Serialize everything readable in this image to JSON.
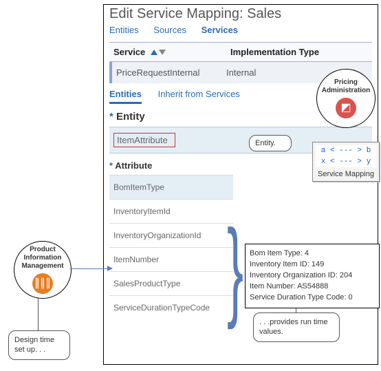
{
  "title": "Edit Service Mapping: Sales",
  "top_tabs": [
    "Entities",
    "Sources",
    "Services"
  ],
  "top_tabs_active": 2,
  "grid": {
    "col_service": "Service",
    "col_impl": "Implementation Type",
    "row": {
      "service": "PriceRequestInternal",
      "impl": "Internal"
    }
  },
  "entity_tabs": [
    "Entities",
    "Inherit from Services"
  ],
  "entity_tabs_active": 0,
  "entity_section_label": "Entity",
  "entity_value": "ItemAttribute",
  "attribute_section_label": "Attribute",
  "attributes": [
    "BomItemType",
    "InventoryItemId",
    "InventoryOrganizationId",
    "ItemNumber",
    "SalesProductType",
    "ServiceDurationTypeCode"
  ],
  "bubbles": {
    "pim": "Product Information Management",
    "pa": "Pricing Administration"
  },
  "speech": {
    "entity": "Entity.",
    "design": "Design time set up. . .",
    "values": ". . .provides  run time values."
  },
  "runtime": {
    "lines": [
      "Bom Item Type: 4",
      "Inventory Item ID: 149",
      "Inventory Organization ID: 204",
      "Item Number: AS54888",
      "Service Duration Type Code: 0"
    ]
  },
  "svc_map": {
    "l1": "a < --- > b",
    "l2": "x < --- > y",
    "label": "Service Mapping"
  }
}
